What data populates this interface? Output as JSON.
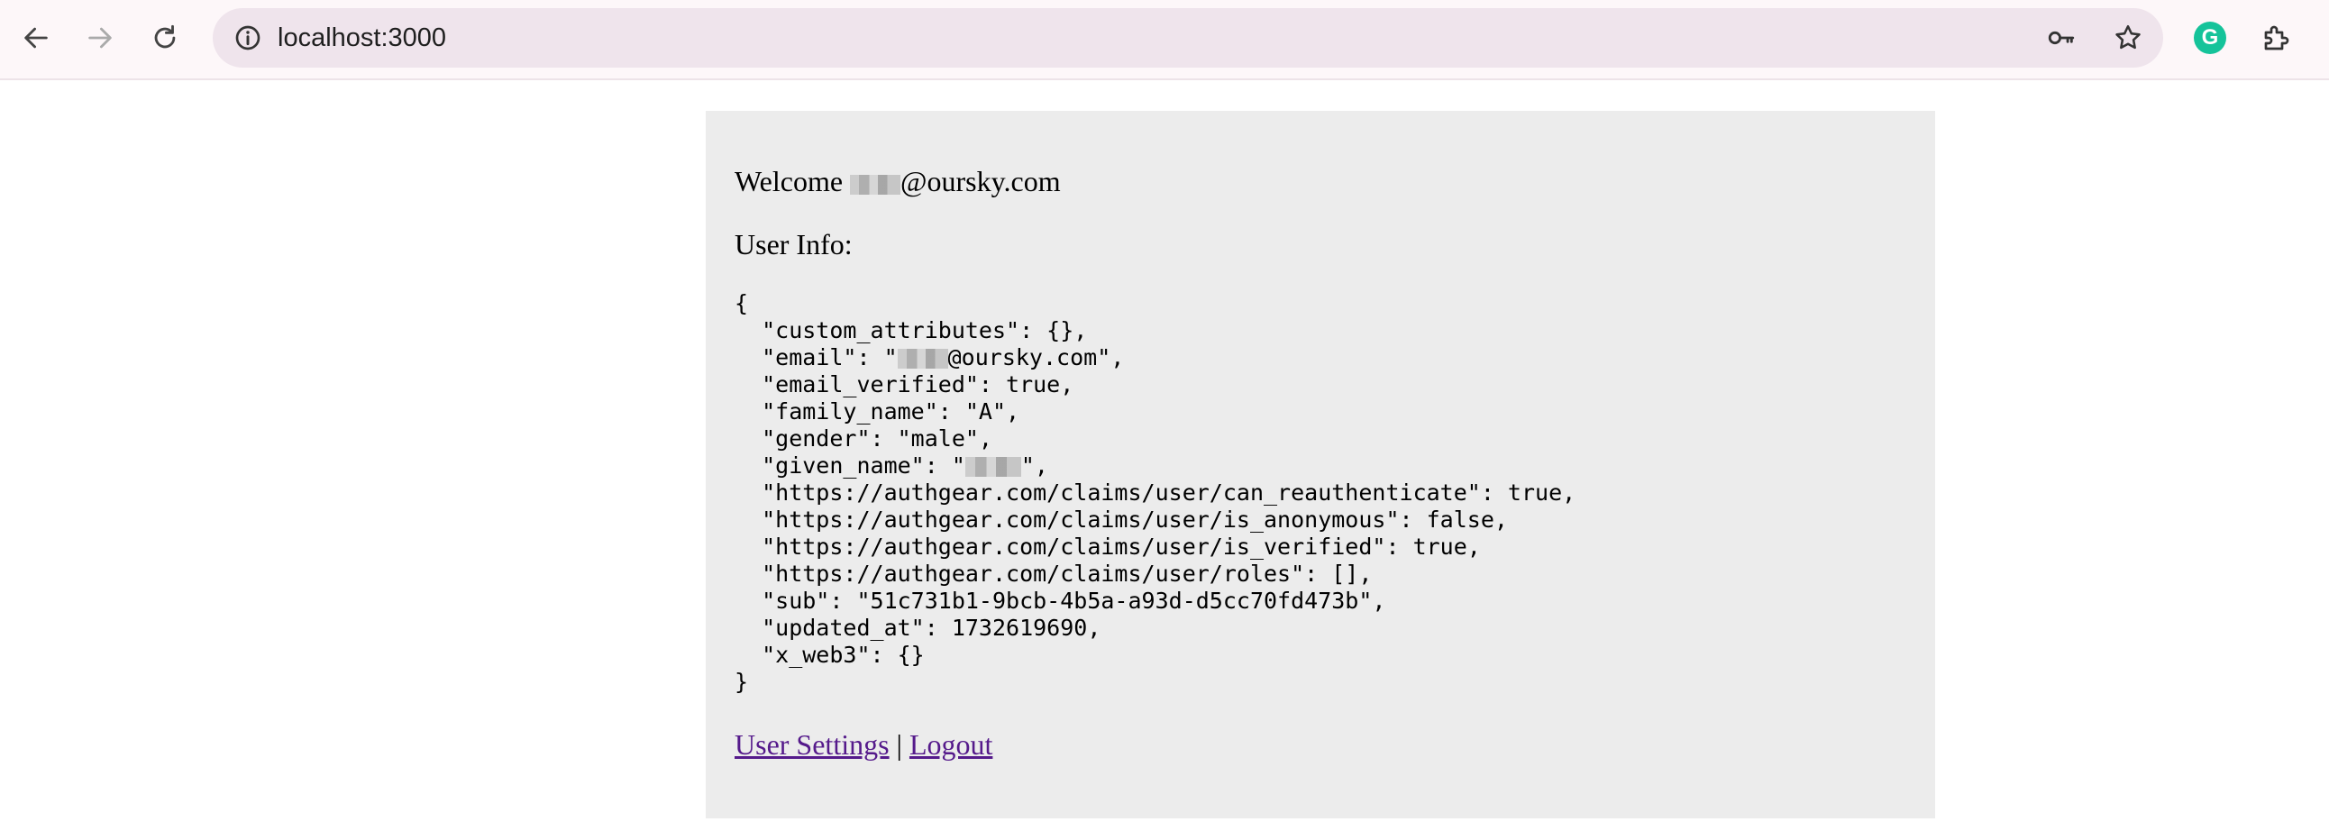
{
  "browser": {
    "url": "localhost:3000",
    "icons": {
      "back": "arrow-left-icon",
      "forward": "arrow-right-icon",
      "reload": "reload-icon",
      "site_info": "info-icon",
      "password": "key-icon",
      "bookmark": "star-icon",
      "grammarly": "grammarly-icon",
      "extensions": "puzzle-icon"
    }
  },
  "page": {
    "welcome_prefix": "Welcome ",
    "welcome_email_domain": "@oursky.com",
    "user_info_label": "User Info:",
    "json_lines": [
      "{",
      "  \"custom_attributes\": {},",
      "  \"email\": \"",
      "  \"email_verified\": true,",
      "  \"family_name\": \"A\",",
      "  \"gender\": \"male\",",
      "  \"given_name\": \"",
      "  \"https://authgear.com/claims/user/can_reauthenticate\": true,",
      "  \"https://authgear.com/claims/user/is_anonymous\": false,",
      "  \"https://authgear.com/claims/user/is_verified\": true,",
      "  \"https://authgear.com/claims/user/roles\": [],",
      "  \"sub\": \"51c731b1-9bcb-4b5a-a93d-d5cc70fd473b\",",
      "  \"updated_at\": 1732619690,",
      "  \"x_web3\": {}",
      "}"
    ],
    "email_suffix": "@oursky.com\",",
    "given_name_suffix": "\",",
    "settings_link": "User Settings",
    "separator": " | ",
    "logout_link": "Logout"
  },
  "colors": {
    "card_background": "#ececec",
    "link": "#551a8b",
    "toolbar": "#fdf7f9",
    "omnibox": "#efe4ec"
  }
}
